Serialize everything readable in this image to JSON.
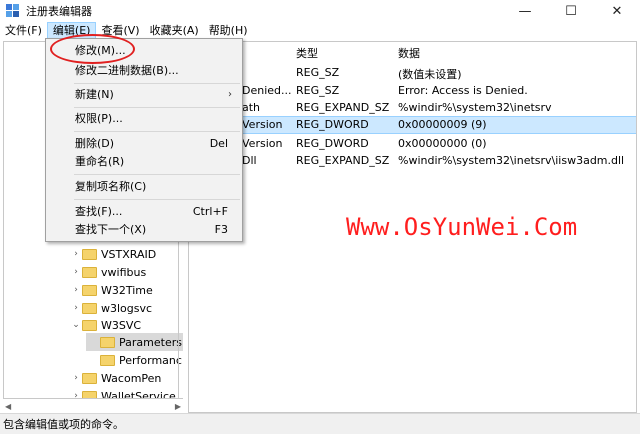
{
  "window": {
    "title": "注册表编辑器",
    "controls": [
      "—",
      "☐",
      "✕"
    ]
  },
  "menubar": [
    "文件(F)",
    "编辑(E)",
    "查看(V)",
    "收藏夹(A)",
    "帮助(H)"
  ],
  "edit_menu": {
    "items": [
      {
        "label": "修改(M)...",
        "shortcut": ""
      },
      {
        "label": "修改二进制数据(B)...",
        "shortcut": ""
      },
      {
        "label": "新建(N)",
        "shortcut": ""
      },
      {
        "label": "权限(P)...",
        "shortcut": ""
      },
      {
        "label": "删除(D)",
        "shortcut": "Del"
      },
      {
        "label": "重命名(R)",
        "shortcut": ""
      },
      {
        "label": "复制项名称(C)",
        "shortcut": ""
      },
      {
        "label": "查找(F)...",
        "shortcut": "Ctrl+F"
      },
      {
        "label": "查找下一个(X)",
        "shortcut": "F3"
      }
    ]
  },
  "tree": {
    "items": [
      {
        "label": "VSTXRAID"
      },
      {
        "label": "vwifibus"
      },
      {
        "label": "W32Time"
      },
      {
        "label": "w3logsvc"
      },
      {
        "label": "W3SVC"
      },
      {
        "label": "Parameters"
      },
      {
        "label": "Performanc"
      },
      {
        "label": "WacomPen"
      },
      {
        "label": "WalletService"
      }
    ]
  },
  "list": {
    "columns": {
      "type": "类型",
      "data": "数据"
    },
    "rows": [
      {
        "name": "",
        "type": "REG_SZ",
        "data": "(数值未设置)"
      },
      {
        "name": "Denied...",
        "type": "REG_SZ",
        "data": "Error: Access is Denied."
      },
      {
        "name": "ath",
        "type": "REG_EXPAND_SZ",
        "data": "%windir%\\system32\\inetsrv"
      },
      {
        "name": "Version",
        "type": "REG_DWORD",
        "data": "0x00000009 (9)"
      },
      {
        "name": "Version",
        "type": "REG_DWORD",
        "data": "0x00000000 (0)"
      },
      {
        "name": "Dll",
        "type": "REG_EXPAND_SZ",
        "data": "%windir%\\system32\\inetsrv\\iisw3adm.dll"
      }
    ]
  },
  "watermark": "Www.OsYunWei.Com",
  "status": "包含编辑值或项的命令。",
  "colors": {
    "selection": "#cce8ff",
    "highlight": "#e02020",
    "watermark": "#ff1e1e"
  }
}
